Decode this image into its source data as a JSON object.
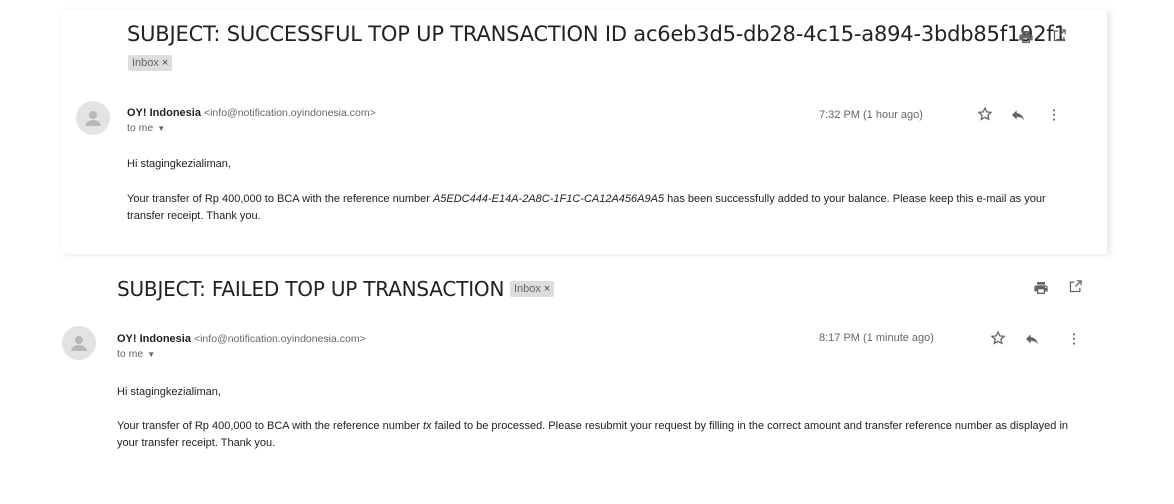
{
  "emails": [
    {
      "subject": "SUBJECT: SUCCESSFUL TOP UP TRANSACTION ID ac6eb3d5-db28-4c15-a894-3bdb85f192f1",
      "label": "Inbox",
      "label_close": "×",
      "sender_name": "OY! Indonesia",
      "sender_email": "<info@notification.oyindonesia.com>",
      "recipient": "to me",
      "time": "7:32 PM (1 hour ago)",
      "greeting": "Hi stagingkezialiman,",
      "body_before": "Your transfer of Rp 400,000 to BCA with the reference number ",
      "reference": "A5EDC444-E14A-2A8C-1F1C-CA12A456A9A5",
      "body_after": " has been successfully added to your balance. Please keep this e-mail as your transfer receipt. Thank you."
    },
    {
      "subject": "SUBJECT: FAILED TOP UP TRANSACTION",
      "label": "Inbox",
      "label_close": "×",
      "sender_name": "OY! Indonesia",
      "sender_email": "<info@notification.oyindonesia.com>",
      "recipient": "to me",
      "time": "8:17 PM (1 minute ago)",
      "greeting": "Hi stagingkezialiman,",
      "body_before": "Your transfer of Rp 400,000 to BCA with the reference number ",
      "reference": "tx",
      "body_after": " failed to be processed. Please resubmit your request by filling in the correct amount and transfer reference number as displayed in your transfer receipt. Thank you."
    }
  ],
  "icons": {
    "print": "print-icon",
    "open_new_window": "open-in-new-window-icon",
    "star": "star-icon",
    "reply": "reply-icon",
    "more": "more-vertical-icon",
    "avatar": "default-avatar-icon"
  },
  "colors": {
    "text": "#222222",
    "muted": "#666666",
    "chip_bg": "#dddddd",
    "avatar_bg": "#e3e3e3"
  }
}
